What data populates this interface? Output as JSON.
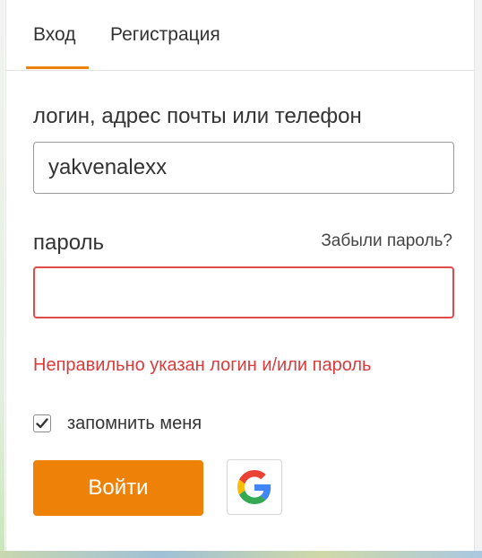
{
  "tabs": {
    "login": "Вход",
    "register": "Регистрация",
    "active": "login"
  },
  "login_field": {
    "label": "логин, адрес почты или телефон",
    "value": "yakvenalexx",
    "placeholder": ""
  },
  "password_field": {
    "label": "пароль",
    "value": "",
    "forgot_link": "Забыли пароль?"
  },
  "error_message": "Неправильно указан логин и/или пароль",
  "remember": {
    "label": "запомнить меня",
    "checked": true
  },
  "submit_label": "Войти",
  "social_icons": [
    "google-icon"
  ],
  "colors": {
    "accent": "#ee8208",
    "error": "#d93b3b",
    "error_border": "#e04a4a"
  }
}
